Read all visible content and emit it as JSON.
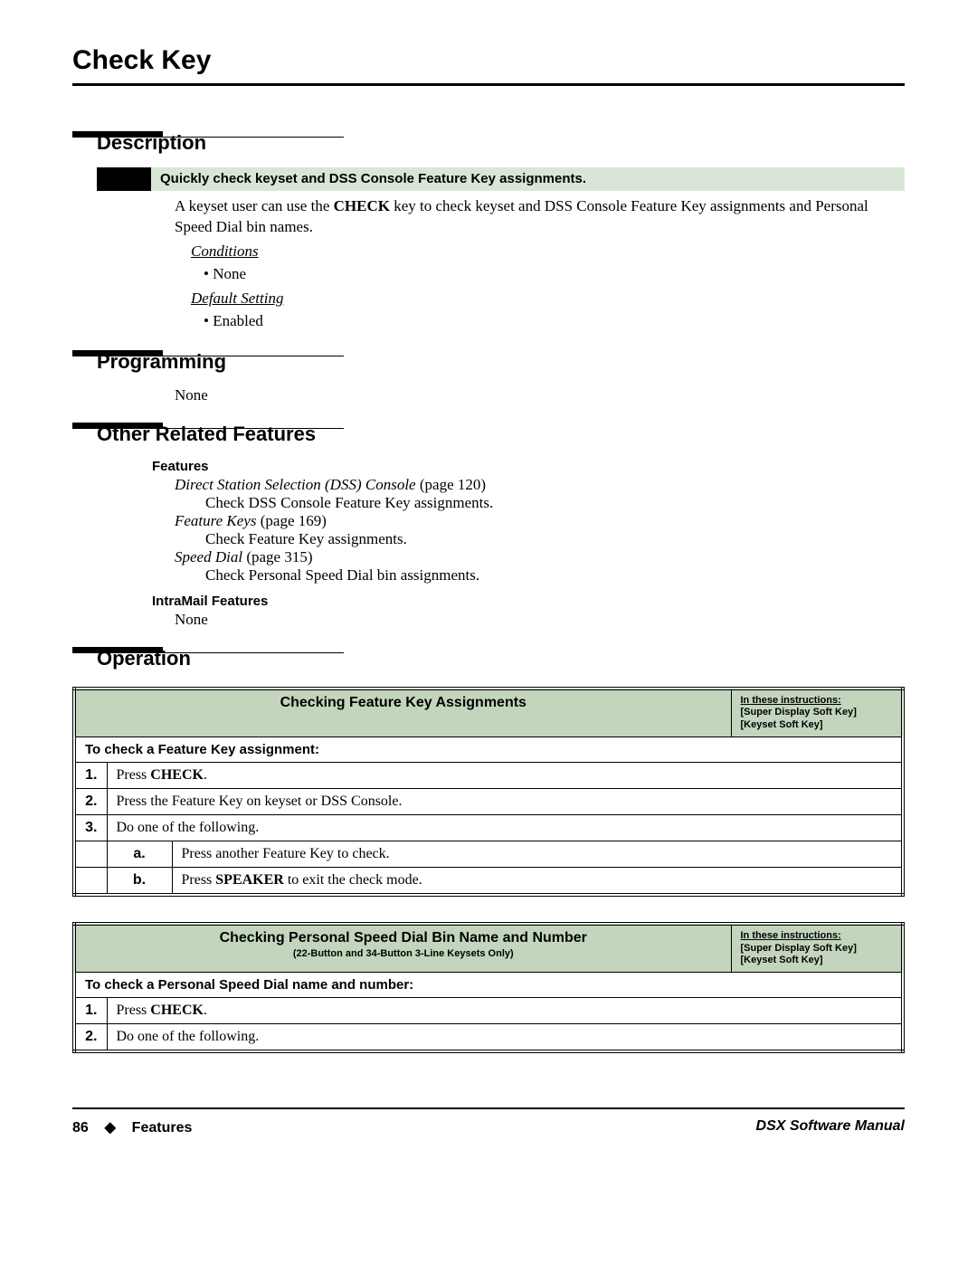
{
  "page_title": "Check Key",
  "sections": {
    "description": {
      "heading": "Description",
      "callout": "Quickly check keyset and DSS Console Feature Key assignments.",
      "para_prefix": "A keyset user can use the ",
      "para_keyword": "CHECK",
      "para_suffix": " key to check keyset and DSS Console Feature Key assignments and Personal Speed Dial bin names.",
      "conditions_label": "Conditions",
      "conditions_value": "None",
      "default_label": "Default Setting",
      "default_value": "Enabled"
    },
    "programming": {
      "heading": "Programming",
      "body": "None"
    },
    "other": {
      "heading": "Other Related Features",
      "features_label": "Features",
      "items": [
        {
          "title": "Direct Station Selection (DSS) Console",
          "page": " (page 120)",
          "desc": "Check DSS Console Feature Key assignments."
        },
        {
          "title": "Feature Keys",
          "page": " (page 169)",
          "desc": "Check Feature Key assignments."
        },
        {
          "title": "Speed Dial",
          "page": " (page 315)",
          "desc": "Check Personal Speed Dial bin assignments."
        }
      ],
      "intramail_label": "IntraMail Features",
      "intramail_value": "None"
    },
    "operation": {
      "heading": "Operation"
    }
  },
  "op_note": {
    "line1": "In these instructions:",
    "line2": "[Super Display Soft Key]",
    "line3": "[Keyset Soft Key]"
  },
  "table1": {
    "title": "Checking Feature Key Assignments",
    "subhead": "To check a Feature Key assignment:",
    "rows": [
      {
        "n": "1.",
        "text_pre": "Press ",
        "text_bold": "CHECK",
        "text_post": "."
      },
      {
        "n": "2.",
        "text_pre": "Press the Feature Key on keyset or DSS Console.",
        "text_bold": "",
        "text_post": ""
      },
      {
        "n": "3.",
        "text_pre": "Do one of the following.",
        "text_bold": "",
        "text_post": ""
      }
    ],
    "subrows": [
      {
        "k": "a.",
        "text_pre": "Press another Feature Key to check.",
        "text_bold": "",
        "text_post": ""
      },
      {
        "k": "b.",
        "text_pre": "Press ",
        "text_bold": "SPEAKER",
        "text_post": " to exit the check mode."
      }
    ]
  },
  "table2": {
    "title": "Checking Personal Speed Dial Bin Name and Number",
    "subtitle": "(22-Button and 34-Button 3-Line Keysets Only)",
    "subhead": "To check a Personal Speed Dial name and number:",
    "rows": [
      {
        "n": "1.",
        "text_pre": "Press ",
        "text_bold": "CHECK",
        "text_post": "."
      },
      {
        "n": "2.",
        "text_pre": "Do one of the following.",
        "text_bold": "",
        "text_post": ""
      }
    ]
  },
  "footer": {
    "page_num": "86",
    "diamond": "◆",
    "section": "Features",
    "manual": "DSX Software Manual"
  }
}
